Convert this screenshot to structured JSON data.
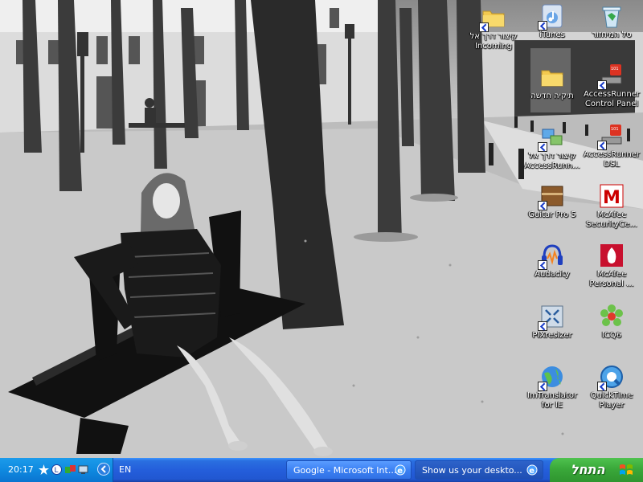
{
  "desktop": {
    "icons": [
      {
        "id": "recycle-bin",
        "label": "סל המיחזור",
        "icon": "recycle-bin-icon"
      },
      {
        "id": "itunes",
        "label": "iTunes",
        "icon": "itunes-icon"
      },
      {
        "id": "incoming",
        "label": "קיצור דרך אל Incoming",
        "icon": "folder-icon"
      },
      {
        "id": "access-control",
        "label": "AccessRunner Control Panel",
        "icon": "accessrunner-icon"
      },
      {
        "id": "new-folder",
        "label": "תיקיה חדשה",
        "icon": "folder-icon"
      },
      {
        "id": "access-dsl",
        "label": "AccessRunner DSL",
        "icon": "accessrunner-icon"
      },
      {
        "id": "access-shortcut",
        "label": "קיצור דרך אל AccessRunn...",
        "icon": "network-icon"
      },
      {
        "id": "mcafee-security",
        "label": "McAfee SecurityCe...",
        "icon": "mcafee-icon"
      },
      {
        "id": "guitar-pro",
        "label": "Guitar Pro 5",
        "icon": "guitar-icon"
      },
      {
        "id": "mcafee-personal",
        "label": "McAfee Personal ...",
        "icon": "mcafee-firewall-icon"
      },
      {
        "id": "audacity",
        "label": "Audacity",
        "icon": "audacity-icon"
      },
      {
        "id": "icq",
        "label": "ICQ6",
        "icon": "icq-flower-icon"
      },
      {
        "id": "pixresizer",
        "label": "PIXresizer",
        "icon": "pixresizer-icon"
      },
      {
        "id": "quicktime",
        "label": "QuickTime Player",
        "icon": "quicktime-icon"
      },
      {
        "id": "imtranslator",
        "label": "ImTranslator for IE",
        "icon": "globe-icon"
      }
    ]
  },
  "taskbar": {
    "clock": "20:17",
    "language": "EN",
    "tasks": [
      {
        "label": "Google - Microsoft Int...",
        "icon": "ie-icon"
      },
      {
        "label": "Show us your deskto...",
        "icon": "ie-icon"
      }
    ],
    "start_label": "התחל",
    "colors": {
      "bar": "#245edb",
      "tray": "#0f8ae0",
      "start": "#3aa83a"
    }
  }
}
